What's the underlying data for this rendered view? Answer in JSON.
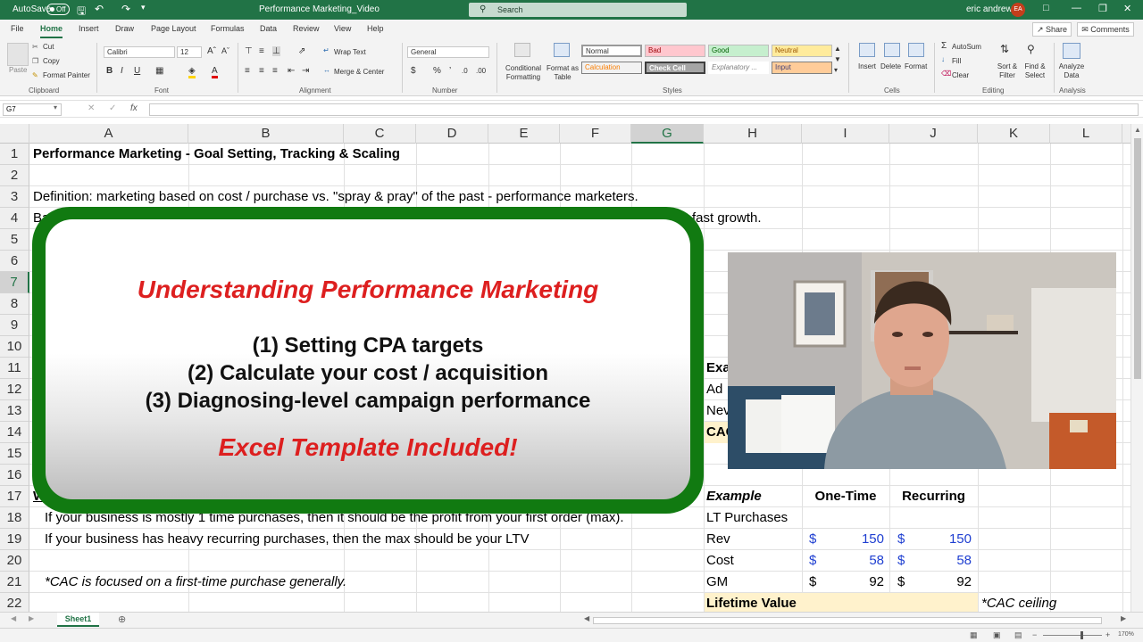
{
  "titlebar": {
    "autosave_label": "AutoSave",
    "autosave_state": "Off",
    "document_title": "Performance Marketing_Video",
    "search_placeholder": "Search",
    "user_name": "eric andrews",
    "user_initials": "EA"
  },
  "menu": {
    "tabs": [
      "File",
      "Home",
      "Insert",
      "Draw",
      "Page Layout",
      "Formulas",
      "Data",
      "Review",
      "View",
      "Help"
    ],
    "active_tab": "Home",
    "share_label": "Share",
    "comments_label": "Comments"
  },
  "ribbon": {
    "clipboard": {
      "paste": "Paste",
      "cut": "Cut",
      "copy": "Copy",
      "format_painter": "Format Painter",
      "label": "Clipboard"
    },
    "font": {
      "name": "Calibri",
      "size": "12",
      "label": "Font"
    },
    "alignment": {
      "wrap_text": "Wrap Text",
      "merge_center": "Merge & Center",
      "label": "Alignment"
    },
    "number": {
      "format": "General",
      "label": "Number"
    },
    "styles": {
      "conditional_formatting": "Conditional Formatting",
      "format_as_table": "Format as Table",
      "normal": "Normal",
      "bad": "Bad",
      "good": "Good",
      "neutral": "Neutral",
      "calculation": "Calculation",
      "check_cell": "Check Cell",
      "explanatory": "Explanatory ...",
      "input": "Input",
      "label": "Styles"
    },
    "cells": {
      "insert": "Insert",
      "delete": "Delete",
      "format": "Format",
      "label": "Cells"
    },
    "editing": {
      "autosum": "AutoSum",
      "fill": "Fill",
      "clear": "Clear",
      "sort_filter": "Sort & Filter",
      "find_select": "Find & Select",
      "label": "Editing"
    },
    "analysis": {
      "analyze_data": "Analyze Data",
      "label": "Analysis"
    }
  },
  "formula_bar": {
    "name_box": "G7",
    "content": ""
  },
  "grid": {
    "columns": [
      "A",
      "B",
      "C",
      "D",
      "E",
      "F",
      "G",
      "H",
      "I",
      "J",
      "K",
      "L"
    ],
    "selected_column": "G",
    "rows": [
      "1",
      "2",
      "3",
      "4",
      "5",
      "6",
      "7",
      "8",
      "9",
      "10",
      "11",
      "12",
      "13",
      "14",
      "15",
      "16",
      "17",
      "18",
      "19",
      "20",
      "21",
      "22"
    ],
    "selected_row": "7",
    "cells": {
      "a1": "Performance Marketing - Goal Setting, Tracking & Scaling",
      "a3": "Definition: marketing based on cost / purchase vs. \"spray & pray\" of the past - performance marketers.",
      "a4": "Ba",
      "a4_end": "ly fast growth.",
      "h11": "Exa",
      "h12": "Ad",
      "h13": "Nev",
      "h14": "CAC",
      "a17": "W",
      "a18": "If your business is mostly 1 time purchases, then it should be the profit from your first order (max).",
      "a19": "If your business has heavy recurring purchases, then the max should be your LTV",
      "a21": "*CAC is focused on a first-time purchase generally.",
      "h17": "Example",
      "i17": "One-Time",
      "j17": "Recurring",
      "h18": "LT Purchases",
      "h19": "Rev",
      "h20": "Cost",
      "h21": "GM",
      "h22": "Lifetime Value",
      "k22": "*CAC ceiling",
      "currency": "$",
      "i19": "150",
      "j19": "150",
      "i20": "58",
      "j20": "58",
      "i21": "92",
      "j21": "92"
    }
  },
  "overlay": {
    "title": "Understanding Performance Marketing",
    "line1": "(1) Setting CPA targets",
    "line2": "(2) Calculate your cost / acquisition",
    "line3": "(3) Diagnosing-level campaign performance",
    "footer": "Excel Template Included!"
  },
  "sheets": {
    "active": "Sheet1"
  },
  "status": {
    "zoom": "170%"
  },
  "colors": {
    "excel_green": "#217346",
    "overlay_border": "#117a11",
    "overlay_red": "#dd1f1f",
    "number_blue": "#1f3fd1",
    "highlight_yellow": "#fff2cc"
  }
}
